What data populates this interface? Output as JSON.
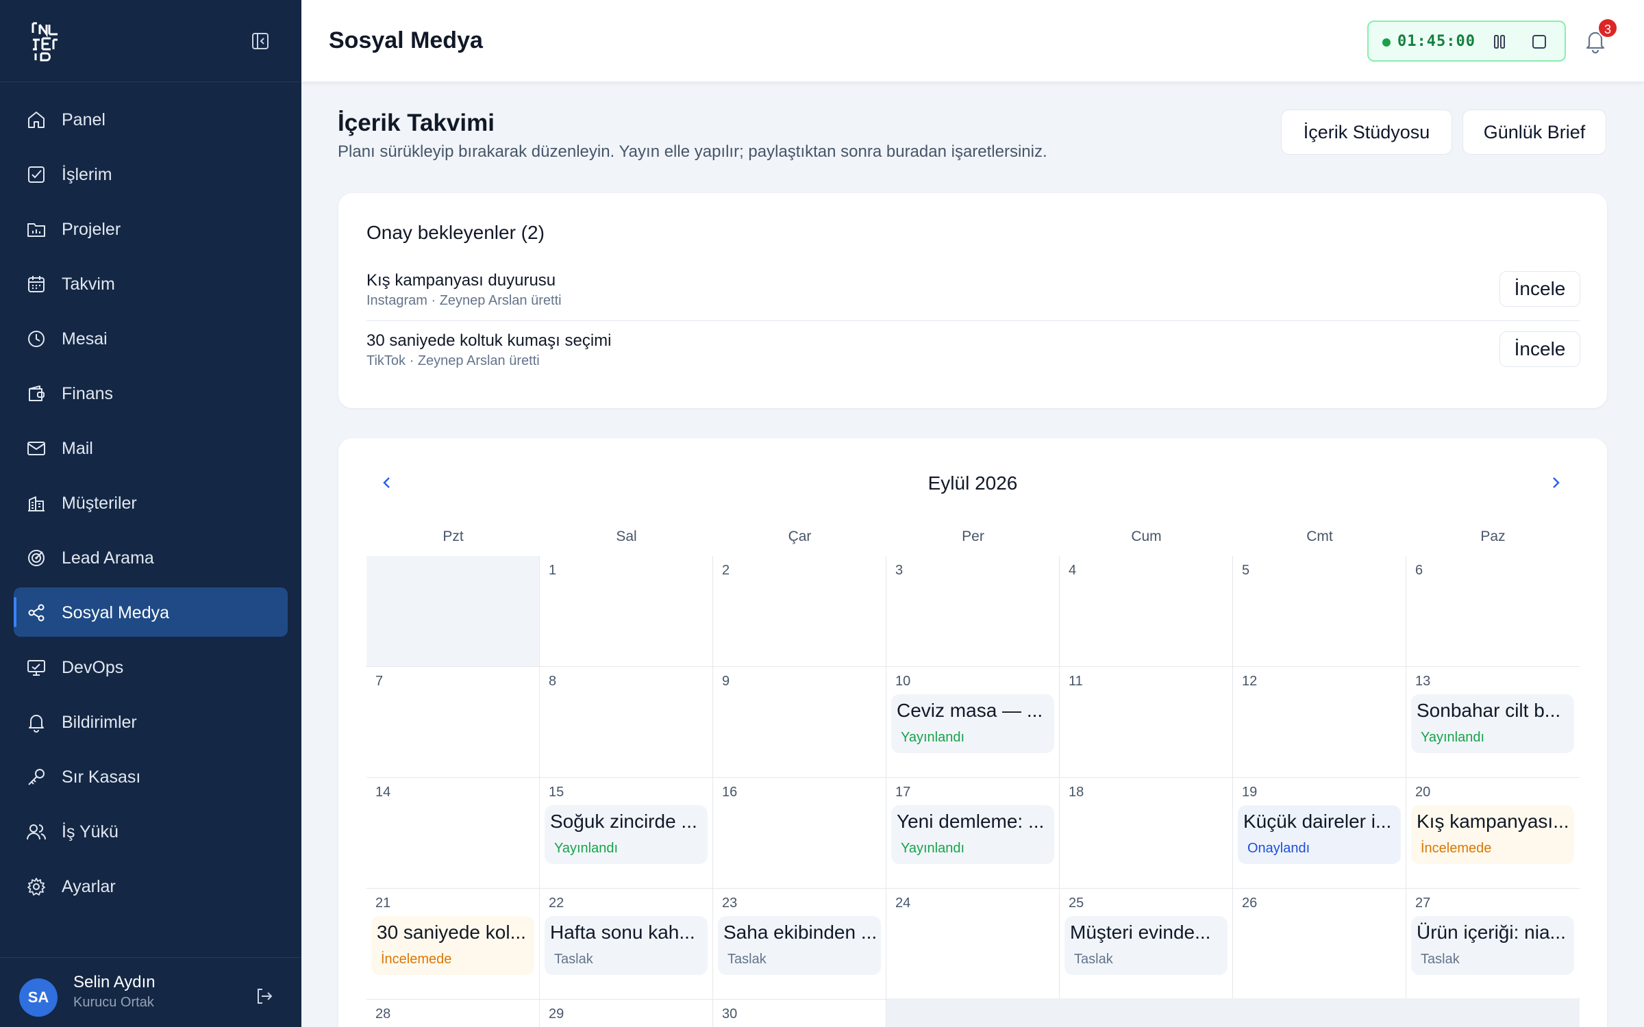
{
  "sidebar": {
    "items": [
      {
        "label": "Panel",
        "icon": "home-icon"
      },
      {
        "label": "İşlerim",
        "icon": "checkbox-icon"
      },
      {
        "label": "Projeler",
        "icon": "folder-chart-icon"
      },
      {
        "label": "Takvim",
        "icon": "calendar-icon"
      },
      {
        "label": "Mesai",
        "icon": "clock-icon"
      },
      {
        "label": "Finans",
        "icon": "wallet-icon"
      },
      {
        "label": "Mail",
        "icon": "mail-icon"
      },
      {
        "label": "Müşteriler",
        "icon": "building-icon"
      },
      {
        "label": "Lead Arama",
        "icon": "radar-icon"
      },
      {
        "label": "Sosyal Medya",
        "icon": "share-icon"
      },
      {
        "label": "DevOps",
        "icon": "monitor-icon"
      },
      {
        "label": "Bildirimler",
        "icon": "bell-icon"
      },
      {
        "label": "Sır Kasası",
        "icon": "key-icon"
      },
      {
        "label": "İş Yükü",
        "icon": "users-icon"
      },
      {
        "label": "Ayarlar",
        "icon": "gear-icon"
      }
    ],
    "active_index": 9,
    "user": {
      "initials": "SA",
      "name": "Selin Aydın",
      "role": "Kurucu Ortak"
    }
  },
  "topbar": {
    "title": "Sosyal Medya",
    "timer": "01:45:00",
    "notification_count": "3"
  },
  "page": {
    "title": "İçerik Takvimi",
    "subtitle": "Planı sürükleyip bırakarak düzenleyin. Yayın elle yapılır; paylaştıktan sonra buradan işaretlersiniz.",
    "studio_button": "İçerik Stüdyosu",
    "brief_button": "Günlük Brief"
  },
  "approvals": {
    "title": "Onay bekleyenler (2)",
    "items": [
      {
        "title": "Kış kampanyası duyurusu",
        "meta": "Instagram · Zeynep Arslan üretti",
        "action": "İncele"
      },
      {
        "title": "30 saniyede koltuk kumaşı seçimi",
        "meta": "TikTok · Zeynep Arslan üretti",
        "action": "İncele"
      }
    ]
  },
  "calendar": {
    "month": "Eylül 2026",
    "weekdays": [
      "Pzt",
      "Sal",
      "Çar",
      "Per",
      "Cum",
      "Cmt",
      "Paz"
    ],
    "weeks": [
      [
        null,
        {
          "day": "1"
        },
        {
          "day": "2"
        },
        {
          "day": "3"
        },
        {
          "day": "4"
        },
        {
          "day": "5"
        },
        {
          "day": "6"
        }
      ],
      [
        {
          "day": "7"
        },
        {
          "day": "8"
        },
        {
          "day": "9"
        },
        {
          "day": "10",
          "event": {
            "title": "Ceviz masa — ...",
            "status": "Yayınlandı",
            "kind": "pub"
          }
        },
        {
          "day": "11"
        },
        {
          "day": "12"
        },
        {
          "day": "13",
          "event": {
            "title": "Sonbahar cilt b...",
            "status": "Yayınlandı",
            "kind": "pub"
          }
        }
      ],
      [
        {
          "day": "14"
        },
        {
          "day": "15",
          "event": {
            "title": "Soğuk zincirde ...",
            "status": "Yayınlandı",
            "kind": "pub"
          }
        },
        {
          "day": "16"
        },
        {
          "day": "17",
          "event": {
            "title": "Yeni demleme: ...",
            "status": "Yayınlandı",
            "kind": "pub"
          }
        },
        {
          "day": "18"
        },
        {
          "day": "19",
          "event": {
            "title": "Küçük daireler i...",
            "status": "Onaylandı",
            "kind": "app"
          }
        },
        {
          "day": "20",
          "event": {
            "title": "Kış kampanyası...",
            "status": "İncelemede",
            "kind": "rev"
          }
        }
      ],
      [
        {
          "day": "21",
          "event": {
            "title": "30 saniyede kol...",
            "status": "İncelemede",
            "kind": "rev"
          }
        },
        {
          "day": "22",
          "event": {
            "title": "Hafta sonu kah...",
            "status": "Taslak",
            "kind": "drf"
          }
        },
        {
          "day": "23",
          "event": {
            "title": "Saha ekibinden ...",
            "status": "Taslak",
            "kind": "drf"
          }
        },
        {
          "day": "24"
        },
        {
          "day": "25",
          "event": {
            "title": "Müşteri evinde...",
            "status": "Taslak",
            "kind": "drf"
          }
        },
        {
          "day": "26"
        },
        {
          "day": "27",
          "event": {
            "title": "Ürün içeriği: nia...",
            "status": "Taslak",
            "kind": "drf"
          }
        }
      ],
      [
        {
          "day": "28"
        },
        {
          "day": "29"
        },
        {
          "day": "30"
        },
        null,
        null,
        null,
        null
      ]
    ]
  },
  "colors": {
    "sidebar_bg": "#142745",
    "active_item": "#1f4a85",
    "published": "#16a34a",
    "approved": "#1d4ed8",
    "in_review": "#d97706",
    "draft": "#64748b",
    "badge": "#dc2626"
  }
}
